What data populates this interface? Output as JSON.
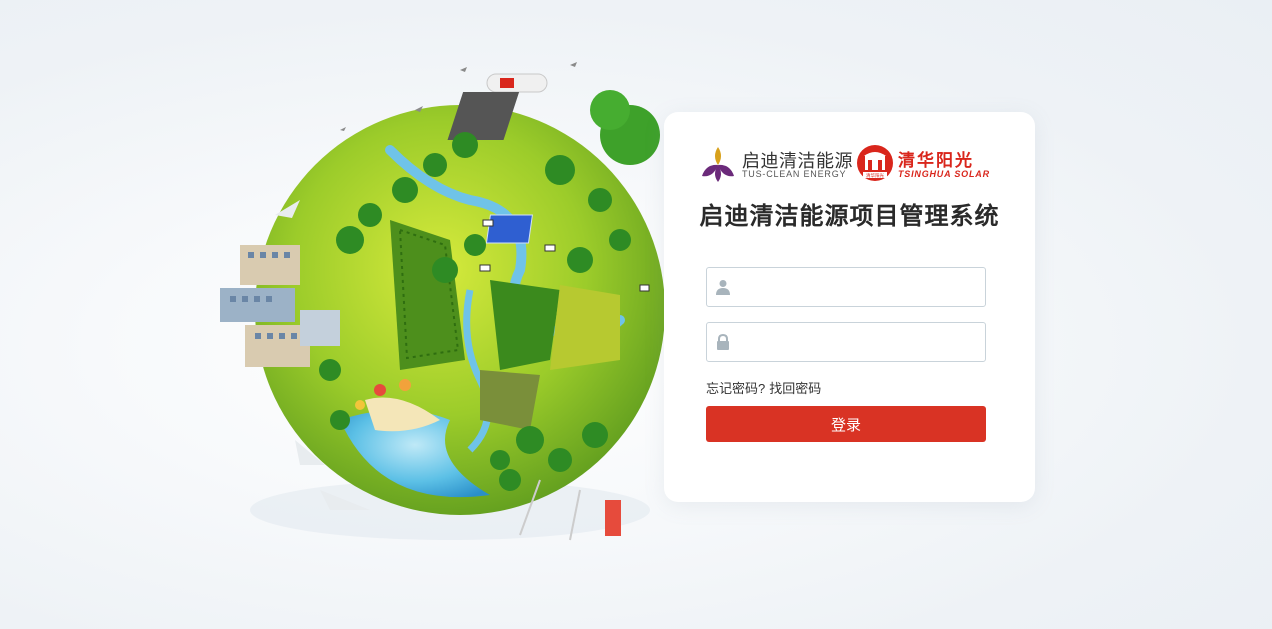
{
  "logos": {
    "tus_cn": "启迪清洁能源",
    "tus_en": "TUS-CLEAN ENERGY",
    "tsinghua_cn": "清华阳光",
    "tsinghua_en": "TSINGHUA SOLAR",
    "tsinghua_stamp": "清华阳光"
  },
  "title": "启迪清洁能源项目管理系统",
  "form": {
    "username_value": "",
    "password_value": "",
    "forgot_prefix": "忘记密码?",
    "forgot_link": "找回密码",
    "login_label": "登录"
  },
  "colors": {
    "accent": "#d93324",
    "tus_purple": "#6b2a7a",
    "tus_gold": "#d8a11c",
    "tsinghua_red": "#d9261c"
  }
}
